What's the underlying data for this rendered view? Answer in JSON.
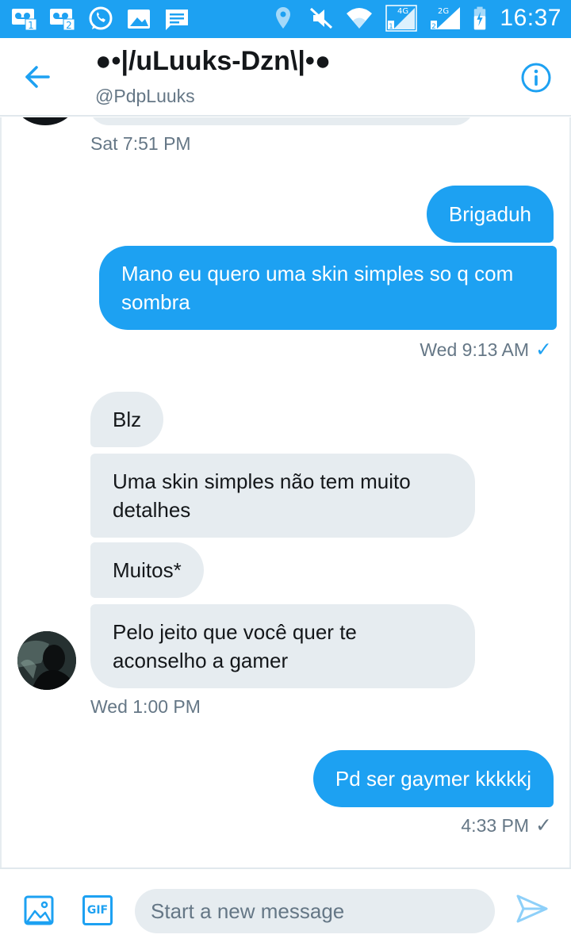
{
  "status_bar": {
    "time": "16:37",
    "left_icons": [
      "voicemail-sim1-icon",
      "voicemail-sim2-icon",
      "whatsapp-icon",
      "gallery-icon",
      "message-icon"
    ],
    "right_icons": [
      "location-icon",
      "mute-icon",
      "wifi-icon",
      "signal-4g-icon",
      "signal-2g-icon",
      "battery-charging-icon"
    ],
    "network_1": "4G",
    "network_2": "2G"
  },
  "header": {
    "title": "●•|/uLuuks-Dzn\\|•●",
    "handle": "@PdpLuuks"
  },
  "messages": [
    {
      "id": "ts1",
      "type": "timestamp",
      "text": "Sat 7:51 PM"
    },
    {
      "id": "m1",
      "dir": "out",
      "text": "Brigaduh"
    },
    {
      "id": "m2",
      "dir": "out",
      "text": "Mano eu quero uma skin simples so q com sombra"
    },
    {
      "id": "ts2",
      "type": "timestamp",
      "text": "Wed 9:13 AM"
    },
    {
      "id": "m3",
      "dir": "in",
      "text": "Blz"
    },
    {
      "id": "m4",
      "dir": "in",
      "text": "Uma skin simples não tem muito detalhes"
    },
    {
      "id": "m5",
      "dir": "in",
      "text": "Muitos*"
    },
    {
      "id": "m6",
      "dir": "in",
      "text": "Pelo jeito que você quer te aconselho a gamer"
    },
    {
      "id": "ts3",
      "type": "timestamp",
      "text": "Wed 1:00 PM"
    },
    {
      "id": "m7",
      "dir": "out",
      "text": "Pd ser gaymer kkkkkj"
    },
    {
      "id": "ts4",
      "type": "timestamp",
      "text": "4:33 PM"
    }
  ],
  "composer": {
    "placeholder": "Start a new message",
    "gif_label": "GIF"
  },
  "colors": {
    "accent": "#1da1f2",
    "incoming_bubble": "#e6ecf0",
    "secondary_text": "#657786"
  }
}
